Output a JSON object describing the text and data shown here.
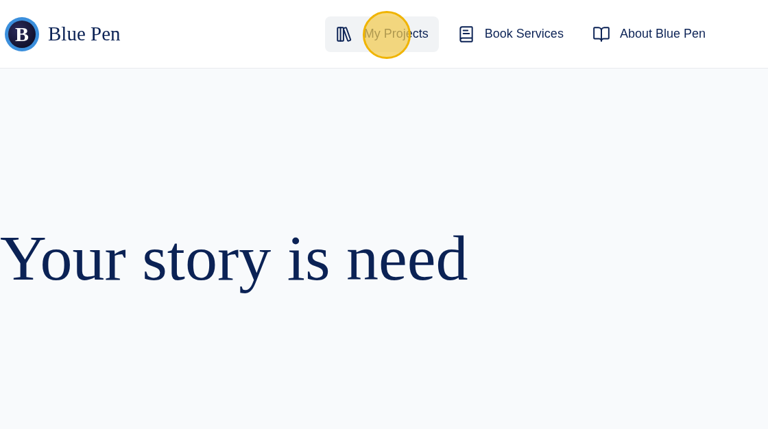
{
  "header": {
    "logo": {
      "letter": "B",
      "name": "Blue Pen"
    },
    "nav": [
      {
        "kind": "projects",
        "label": "My Projects",
        "selected": true
      },
      {
        "kind": "services",
        "label": "Book Services",
        "selected": false
      },
      {
        "kind": "about",
        "label": "About Blue Pen",
        "selected": false
      }
    ]
  },
  "hero": {
    "heading": "Your story is need"
  },
  "click_indicator": {
    "on": true
  }
}
